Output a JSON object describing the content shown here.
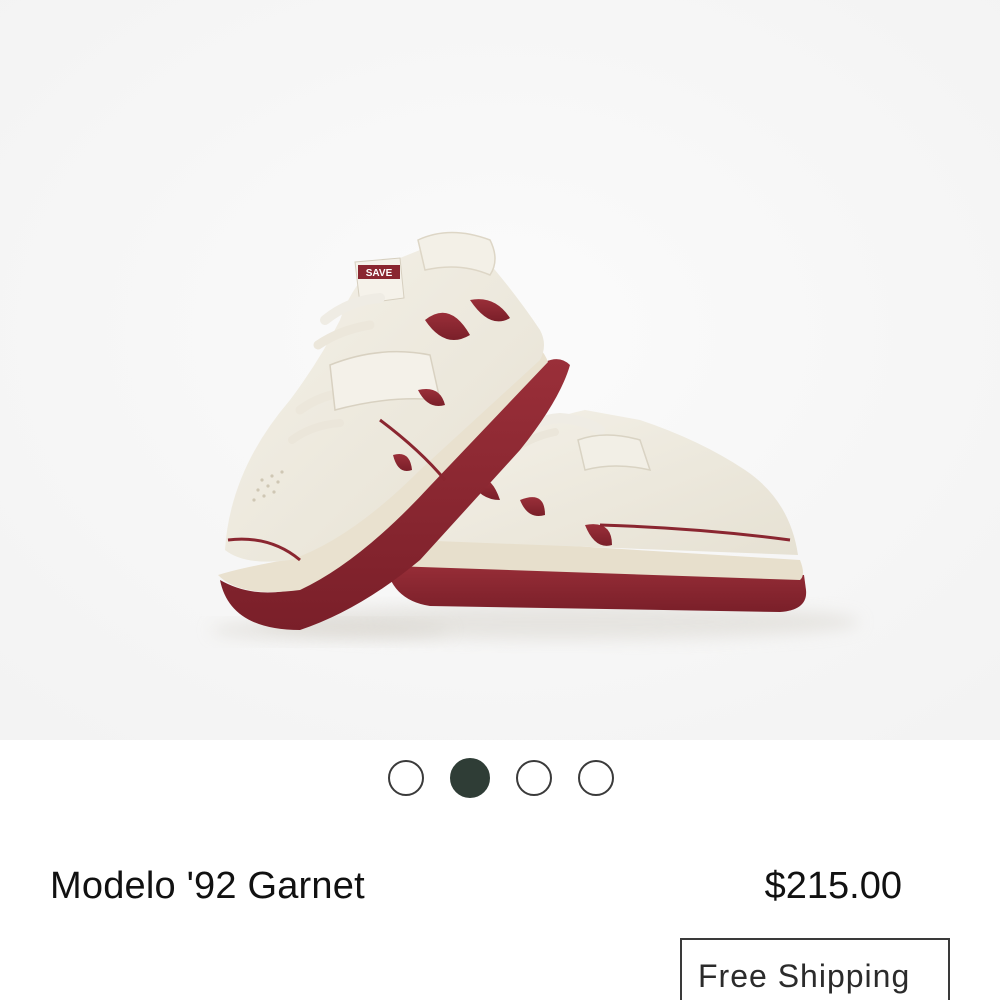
{
  "product": {
    "name": "Modelo '92 Garnet",
    "price": "$215.00",
    "badge": "Free Shipping",
    "image_alt": "Modelo '92 Garnet sneakers",
    "shoe_tag_text": "SAVE"
  },
  "carousel": {
    "count": 4,
    "active_index": 1
  },
  "colors": {
    "shoe_cream": "#efebe0",
    "garnet": "#8a2630",
    "dot_active": "#2f3d36",
    "image_background": "#f7f7f7"
  }
}
